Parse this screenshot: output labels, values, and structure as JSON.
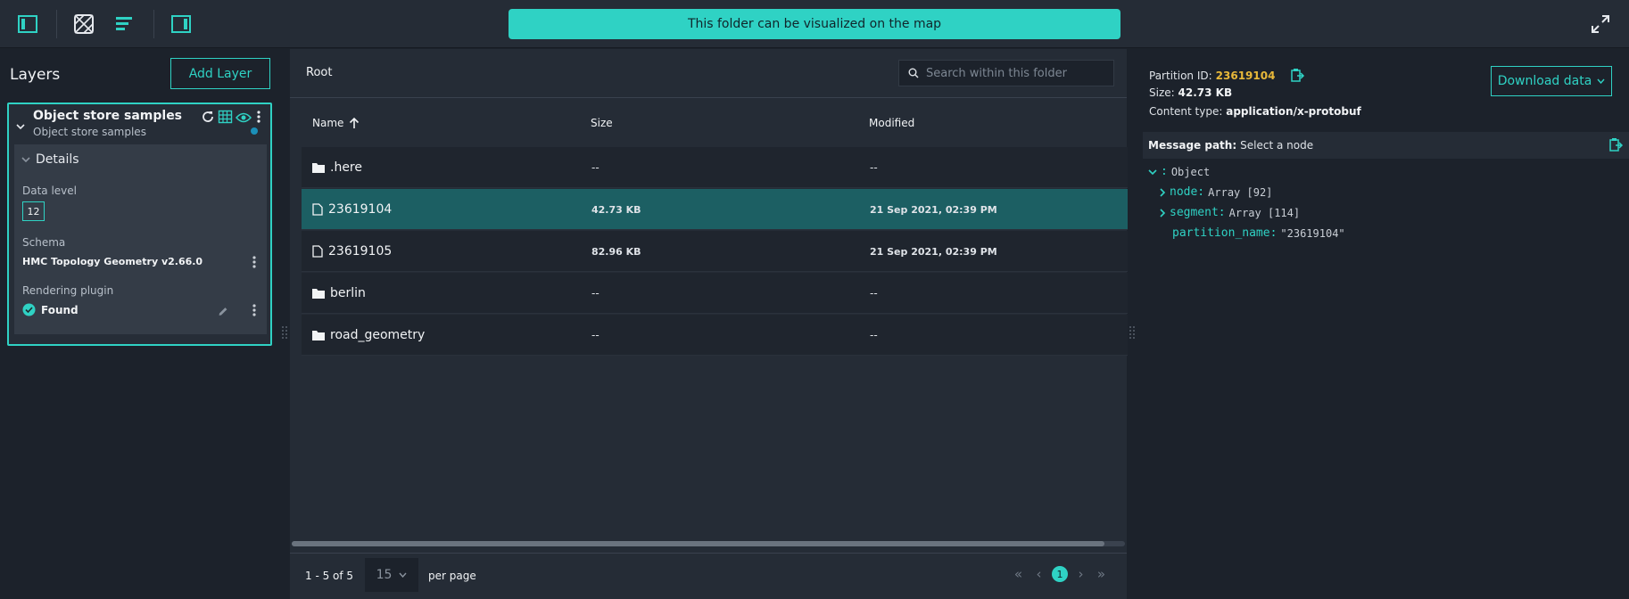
{
  "banner": "This folder can be visualized on the map",
  "layers": {
    "title": "Layers",
    "add_button": "Add Layer",
    "card": {
      "title": "Object store samples",
      "subtitle": "Object store samples",
      "details_label": "Details",
      "data_level_label": "Data level",
      "data_level_value": "12",
      "schema_label": "Schema",
      "schema_value": "HMC Topology Geometry v2.66.0",
      "plugin_label": "Rendering plugin",
      "plugin_value": "Found"
    }
  },
  "browser": {
    "breadcrumb": "Root",
    "search_placeholder": "Search within this folder",
    "columns": [
      "Name",
      "Size",
      "Modified"
    ],
    "rows": [
      {
        "name": "here",
        "display": ".here",
        "type": "folder",
        "size": "--",
        "modified": "--"
      },
      {
        "name": "23619104",
        "display": "23619104",
        "type": "file",
        "size": "42.73 KB",
        "modified": "21 Sep 2021, 02:39 PM",
        "selected": true
      },
      {
        "name": "23619105",
        "display": "23619105",
        "type": "file",
        "size": "82.96 KB",
        "modified": "21 Sep 2021, 02:39 PM"
      },
      {
        "name": "berlin",
        "display": "berlin",
        "type": "folder",
        "size": "--",
        "modified": "--"
      },
      {
        "name": "road_geometry",
        "display": "road_geometry",
        "type": "folder",
        "size": "--",
        "modified": "--"
      }
    ],
    "range": "1 - 5 of 5",
    "per_page_value": "15",
    "per_page_label": "per page",
    "current_page": "1",
    "horizontal_scroll": 0.975
  },
  "detail": {
    "partition_label": "Partition ID:",
    "partition_value": "23619104",
    "size_label": "Size:",
    "size_value": "42.73 KB",
    "content_label": "Content type:",
    "content_value": "application/x-protobuf",
    "download_button": "Download data",
    "message_path_label": "Message path:",
    "message_path_value": "Select a node",
    "tree": {
      "root_key": ":",
      "root_value": "Object",
      "node_key": "node:",
      "node_value": "Array [92]",
      "segment_key": "segment:",
      "segment_value": "Array [114]",
      "partition_key": "partition_name:",
      "partition_value": "\"23619104\""
    }
  },
  "colors": {
    "accent": "#2fd2c4",
    "selected_row": "#1c5f63",
    "partition_id": "#e8b839"
  }
}
